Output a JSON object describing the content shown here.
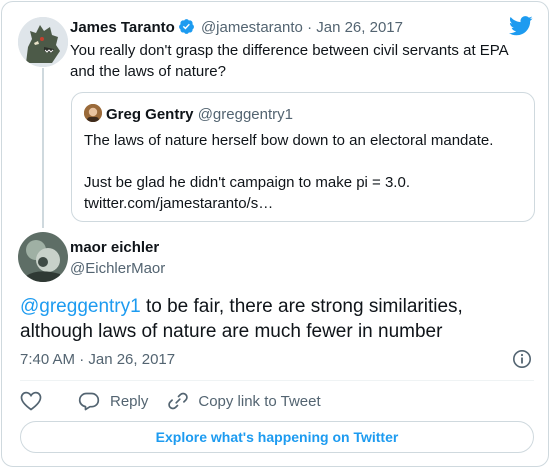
{
  "parent_tweet": {
    "author_name": "James Taranto",
    "author_handle": "@jamestaranto",
    "separator": "·",
    "date": "Jan 26, 2017",
    "text": "You really don't grasp the difference between civil servants at EPA and the laws of nature?",
    "avatar_icon": "godzilla-avatar"
  },
  "quoted_tweet": {
    "author_name": "Greg Gentry",
    "author_handle": "@greggentry1",
    "text_line1": "The laws of nature herself bow down to an electoral mandate.",
    "text_line2": "Just be glad he didn't campaign to make pi = 3.0.",
    "link": "twitter.com/jamestaranto/s…"
  },
  "main_tweet": {
    "author_name": "maor eichler",
    "author_handle": "@EichlerMaor",
    "mention": "@greggentry1",
    "text": " to be fair, there are strong similarities, although laws of nature are much fewer in number",
    "timestamp": "7:40 AM · Jan 26, 2017"
  },
  "actions": {
    "reply_label": "Reply",
    "copy_link_label": "Copy link to Tweet",
    "explore_label": "Explore what's happening on Twitter"
  },
  "colors": {
    "accent": "#1d9bf0",
    "text": "#0f1419",
    "secondary": "#536471",
    "border": "#cfd9de"
  }
}
